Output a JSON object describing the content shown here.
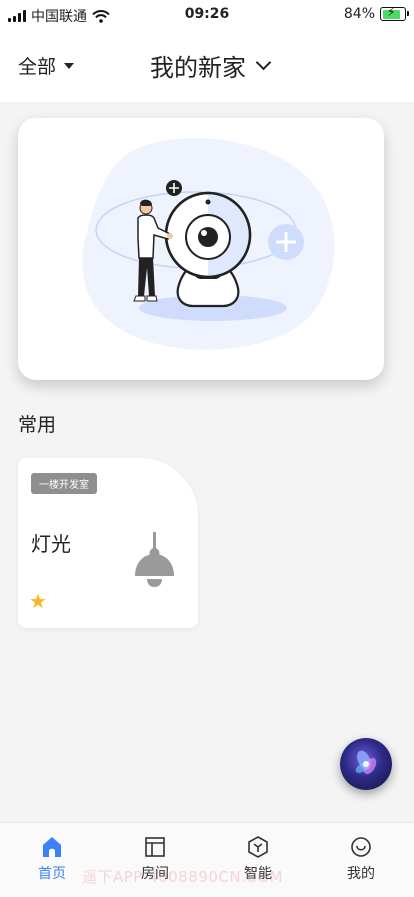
{
  "status_bar": {
    "carrier": "中国联通",
    "time": "09:26",
    "battery": "84%",
    "battery_level": 0.84
  },
  "header": {
    "filter_label": "全部",
    "home_name": "我的新家"
  },
  "section": {
    "title": "常用"
  },
  "device_card": {
    "room": "一楼开发室",
    "name": "灯光",
    "favorited": true,
    "icon": "pendant-lamp-icon"
  },
  "assistant_button": {
    "icon": "voice-assistant-icon"
  },
  "tabbar": {
    "tabs": [
      {
        "label": "首页",
        "icon": "home-icon",
        "active": true
      },
      {
        "label": "房间",
        "icon": "room-icon",
        "active": false
      },
      {
        "label": "智能",
        "icon": "smart-icon",
        "active": false
      },
      {
        "label": "我的",
        "icon": "profile-icon",
        "active": false
      }
    ],
    "watermark": "遥下APP 4008890CN.COM"
  },
  "colors": {
    "accent": "#3b82f6",
    "star": "#f5b623",
    "tag_bg": "#8f8f8f"
  }
}
